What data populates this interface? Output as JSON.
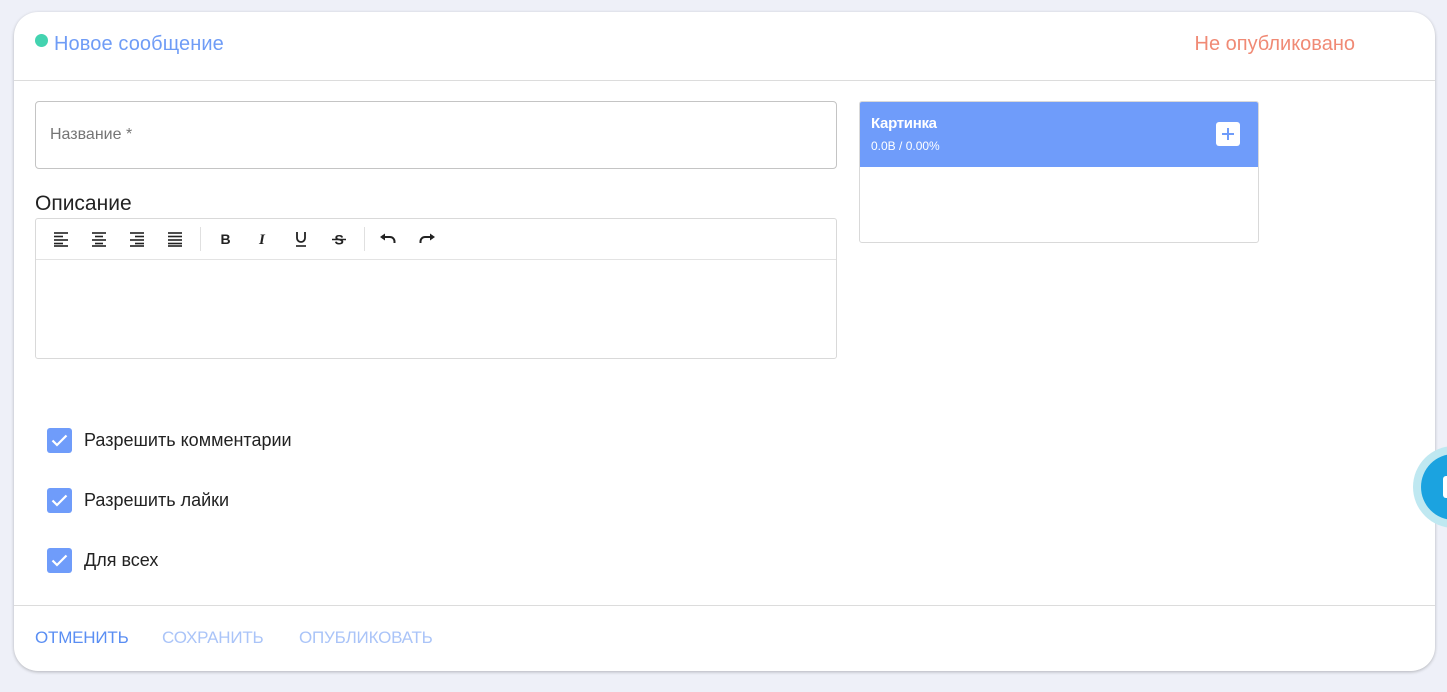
{
  "header": {
    "title": "Новое сообщение",
    "status": "Не опубликовано",
    "status_dot_color": "#43d3b0"
  },
  "form": {
    "name_placeholder": "Название *",
    "name_value": "",
    "description_label": "Описание",
    "description_value": ""
  },
  "toolbar": {
    "buttons": [
      "align-left",
      "align-center",
      "align-right",
      "align-justify",
      "bold",
      "italic",
      "underline",
      "strikethrough",
      "undo",
      "redo"
    ]
  },
  "image_panel": {
    "title": "Картинка",
    "size": "0.0B / 0.00%",
    "accent": "#6f9cfa"
  },
  "options": [
    {
      "label": "Разрешить комментарии",
      "checked": true
    },
    {
      "label": "Разрешить лайки",
      "checked": true
    },
    {
      "label": "Для всех",
      "checked": true
    }
  ],
  "footer": {
    "cancel": "ОТМЕНИТЬ",
    "save": "СОХРАНИТЬ",
    "publish": "ОПУБЛИКОВАТЬ"
  },
  "colors": {
    "accent": "#6f9cfa",
    "unpublished": "#f08a75",
    "chat_button": "#1ba3e0"
  }
}
